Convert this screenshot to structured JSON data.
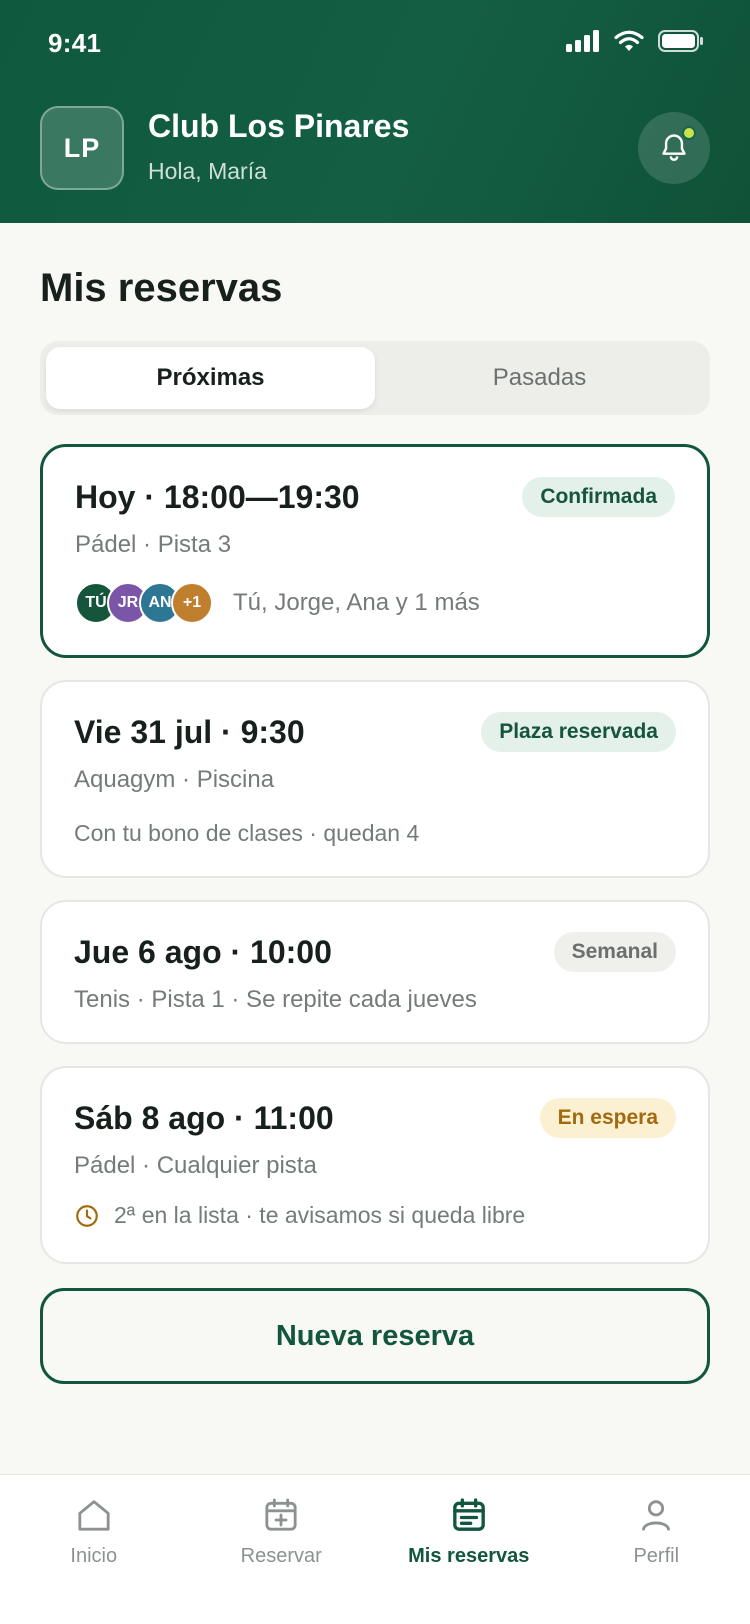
{
  "status_bar": {
    "time": "9:41"
  },
  "header": {
    "avatar_initials": "LP",
    "club_name": "Club Los Pinares",
    "greeting": "Hola, María"
  },
  "page_title": "Mis reservas",
  "tabs": [
    {
      "label": "Próximas",
      "active": true
    },
    {
      "label": "Pasadas",
      "active": false
    }
  ],
  "bookings": [
    {
      "title": "Hoy · 18:00—19:30",
      "subtitle": "Pádel · Pista 3",
      "status": "Confirmada",
      "status_color": "#15553c",
      "participants": [
        {
          "initials": "TÚ",
          "color": "#15553c"
        },
        {
          "initials": "JR",
          "color": "#7b55a8"
        },
        {
          "initials": "AN",
          "color": "#2d7795"
        },
        {
          "initials": "+1",
          "color": "#c07f2c"
        }
      ],
      "participants_text": "Tú, Jorge, Ana y 1 más"
    },
    {
      "title": "Vie 31 jul · 9:30",
      "subtitle": "Aquagym · Piscina",
      "status": "Plaza reservada",
      "note": "Con tu bono de clases · quedan 4"
    },
    {
      "title": "Jue 6 ago · 10:00",
      "subtitle": "Tenis · Pista 1 · Se repite cada jueves",
      "status": "Semanal"
    },
    {
      "title": "Sáb 8 ago · 11:00",
      "subtitle": "Pádel · Cualquier pista",
      "status": "En espera",
      "status_color": "#a26a0e",
      "note": "2ª en la lista · te avisamos si queda libre",
      "note_icon": "clock-icon"
    }
  ],
  "new_booking_label": "Nueva reserva",
  "bottom_nav": [
    {
      "label": "Inicio",
      "icon": "home-icon",
      "active": false
    },
    {
      "label": "Reservar",
      "icon": "calendar-plus-icon",
      "active": false
    },
    {
      "label": "Mis reservas",
      "icon": "calendar-list-icon",
      "active": true
    },
    {
      "label": "Perfil",
      "icon": "person-icon",
      "active": false
    }
  ],
  "colors": {
    "brand": "#11563d",
    "notification_dot": "#c9e34b"
  }
}
